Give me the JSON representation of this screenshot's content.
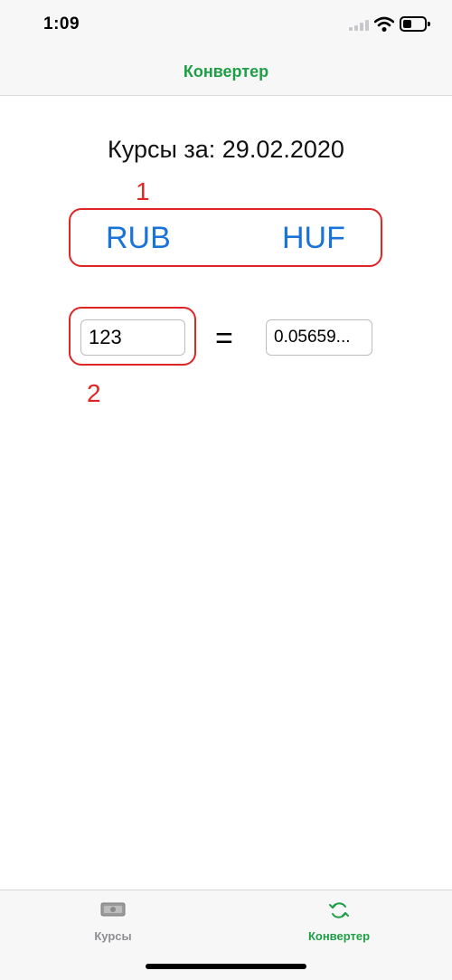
{
  "status_bar": {
    "time": "1:09"
  },
  "nav": {
    "title": "Конвертер"
  },
  "rates": {
    "date_label": "Курсы за: 29.02.2020"
  },
  "currencies": {
    "from": "RUB",
    "to": "HUF"
  },
  "converter": {
    "amount": "123",
    "equals": "=",
    "result": "0.05659..."
  },
  "annotations": {
    "one": "1",
    "two": "2"
  },
  "tab_bar": {
    "tabs": [
      {
        "label": "Курсы",
        "icon": "banknote-icon",
        "active": false
      },
      {
        "label": "Конвертер",
        "icon": "convert-icon",
        "active": true
      }
    ]
  },
  "colors": {
    "accent": "#1e9e45",
    "link": "#1a73d8",
    "annotation": "#e02525",
    "inactive": "#8e8e93"
  }
}
